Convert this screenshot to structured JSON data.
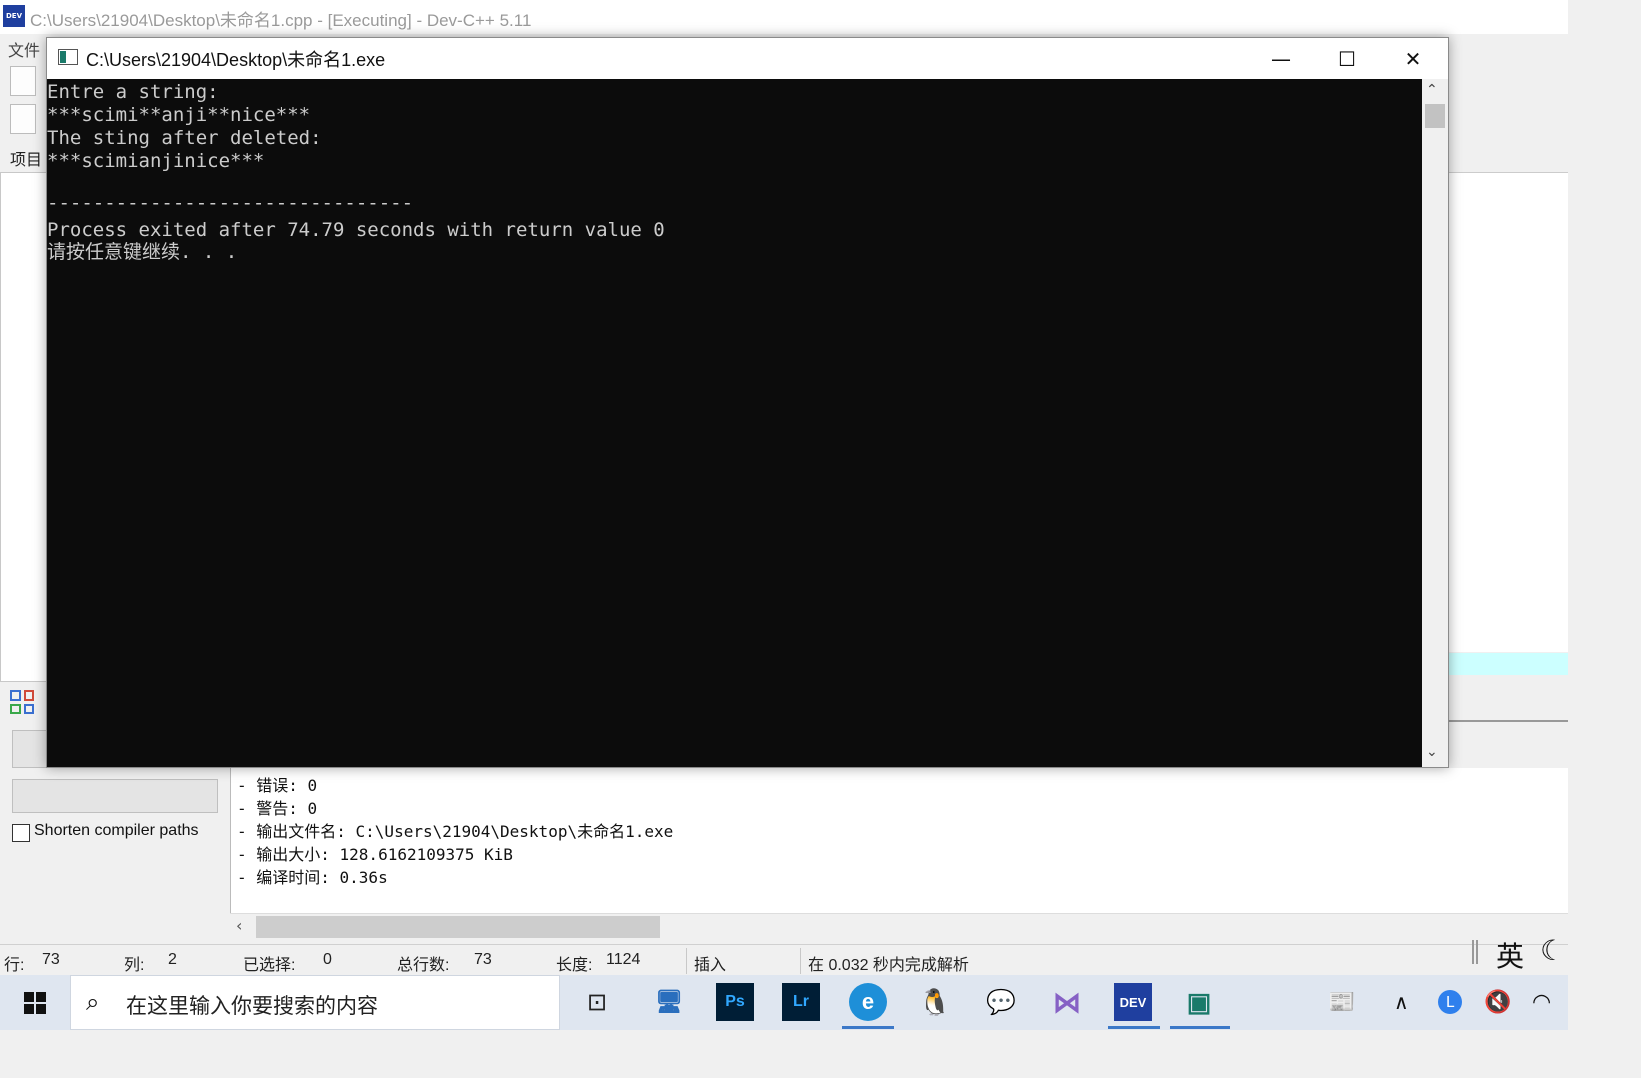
{
  "ide": {
    "window_title": "C:\\Users\\21904\\Desktop\\未命名1.cpp - [Executing] - Dev-C++ 5.11",
    "app_icon_text": "DEV",
    "menu_file": "文件",
    "project_label": "项目",
    "shorten_compiler_paths": "Shorten compiler paths",
    "compile_log": [
      "- 错误: 0",
      "- 警告: 0",
      "- 输出文件名: C:\\Users\\21904\\Desktop\\未命名1.exe",
      "- 输出大小: 128.6162109375 KiB",
      "- 编译时间: 0.36s"
    ],
    "status": {
      "line_label": "行:",
      "line_value": "73",
      "col_label": "列:",
      "col_value": "2",
      "selected_label": "已选择:",
      "selected_value": "0",
      "total_lines_label": "总行数:",
      "total_lines_value": "73",
      "length_label": "长度:",
      "length_value": "1124",
      "mode": "插入",
      "parse_message": "在 0.032 秒内完成解析"
    },
    "ime_language": "英"
  },
  "console": {
    "title": "C:\\Users\\21904\\Desktop\\未命名1.exe",
    "lines": [
      "Entre a string:",
      "***scimi**anji**nice***",
      "The sting after deleted:",
      "***scimianjinice***",
      "",
      "--------------------------------",
      "Process exited after 74.79 seconds with return value 0",
      "请按任意键继续. . ."
    ]
  },
  "taskbar": {
    "search_placeholder": "在这里输入你要搜索的内容",
    "apps": [
      {
        "name": "task-view",
        "label": "⊡"
      },
      {
        "name": "this-pc",
        "label": "🖥"
      },
      {
        "name": "photoshop",
        "label": "Ps"
      },
      {
        "name": "lightroom",
        "label": "Lr"
      },
      {
        "name": "edge",
        "label": "e"
      },
      {
        "name": "qq",
        "label": "🐧"
      },
      {
        "name": "wechat",
        "label": "💬"
      },
      {
        "name": "visual-studio",
        "label": "⋈"
      },
      {
        "name": "devcpp",
        "label": "DEV"
      },
      {
        "name": "console-app",
        "label": "▣"
      }
    ]
  },
  "colors": {
    "console_bg": "#0c0c0c",
    "console_text": "#cccccc",
    "taskbar_bg": "#dfe6f0",
    "highlight_line": "#ccffff"
  }
}
